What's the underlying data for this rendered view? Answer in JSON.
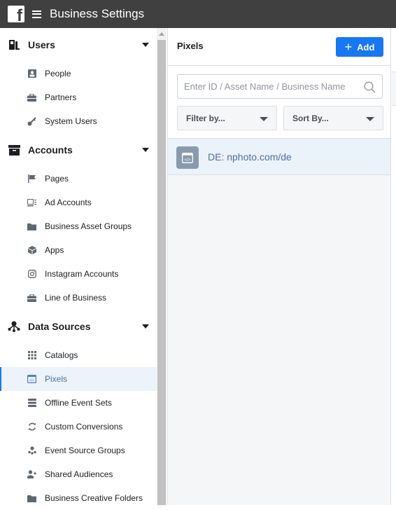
{
  "topbar": {
    "title": "Business Settings",
    "logo": "facebook-logo",
    "menu_icon": "hamburger-icon"
  },
  "sidebar": {
    "sections": [
      {
        "label": "Users",
        "icon": "users-icon",
        "items": [
          {
            "label": "People",
            "icon": "person-icon"
          },
          {
            "label": "Partners",
            "icon": "briefcase-icon"
          },
          {
            "label": "System Users",
            "icon": "key-icon"
          }
        ]
      },
      {
        "label": "Accounts",
        "icon": "archive-icon",
        "items": [
          {
            "label": "Pages",
            "icon": "flag-icon"
          },
          {
            "label": "Ad Accounts",
            "icon": "ad-account-icon"
          },
          {
            "label": "Business Asset Groups",
            "icon": "folder-icon"
          },
          {
            "label": "Apps",
            "icon": "cube-icon"
          },
          {
            "label": "Instagram Accounts",
            "icon": "instagram-icon"
          },
          {
            "label": "Line of Business",
            "icon": "briefcase-icon"
          }
        ]
      },
      {
        "label": "Data Sources",
        "icon": "data-sources-icon",
        "items": [
          {
            "label": "Catalogs",
            "icon": "grid-icon"
          },
          {
            "label": "Pixels",
            "icon": "pixel-code-icon",
            "active": true
          },
          {
            "label": "Offline Event Sets",
            "icon": "offline-events-icon"
          },
          {
            "label": "Custom Conversions",
            "icon": "refresh-icon"
          },
          {
            "label": "Event Source Groups",
            "icon": "event-source-icon"
          },
          {
            "label": "Shared Audiences",
            "icon": "add-person-icon"
          },
          {
            "label": "Business Creative Folders",
            "icon": "folder-icon"
          }
        ]
      }
    ]
  },
  "main": {
    "title": "Pixels",
    "add_label": "Add",
    "search": {
      "placeholder": "Enter ID / Asset Name / Business Name",
      "value": ""
    },
    "filter_label": "Filter by...",
    "sort_label": "Sort By...",
    "rows": [
      {
        "label": "DE: nphoto.com/de",
        "icon": "pixel-code-icon"
      }
    ]
  },
  "colors": {
    "topbar": "#404040",
    "accent": "#1877f2",
    "active_bg": "#ecf3fb",
    "link": "#4b6fa8"
  }
}
